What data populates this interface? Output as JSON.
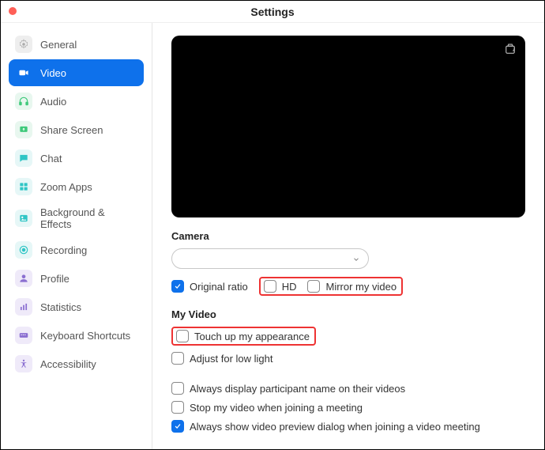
{
  "window": {
    "title": "Settings"
  },
  "sidebar": {
    "items": [
      {
        "label": "General"
      },
      {
        "label": "Video"
      },
      {
        "label": "Audio"
      },
      {
        "label": "Share Screen"
      },
      {
        "label": "Chat"
      },
      {
        "label": "Zoom Apps"
      },
      {
        "label": "Background & Effects"
      },
      {
        "label": "Recording"
      },
      {
        "label": "Profile"
      },
      {
        "label": "Statistics"
      },
      {
        "label": "Keyboard Shortcuts"
      },
      {
        "label": "Accessibility"
      }
    ]
  },
  "camera": {
    "heading": "Camera",
    "selected": "",
    "original_ratio": "Original ratio",
    "hd": "HD",
    "mirror": "Mirror my video"
  },
  "myvideo": {
    "heading": "My Video",
    "touchup": "Touch up my appearance",
    "lowlight": "Adjust for low light"
  },
  "other": {
    "show_names": "Always display participant name on their videos",
    "stop_video": "Stop my video when joining a meeting",
    "preview_dialog": "Always show video preview dialog when joining a video meeting"
  },
  "state": {
    "original_ratio_checked": true,
    "hd_checked": false,
    "mirror_checked": false,
    "touchup_checked": false,
    "lowlight_checked": false,
    "show_names_checked": false,
    "stop_video_checked": false,
    "preview_dialog_checked": true
  },
  "colors": {
    "accent": "#0e71eb",
    "highlight": "#e33"
  }
}
